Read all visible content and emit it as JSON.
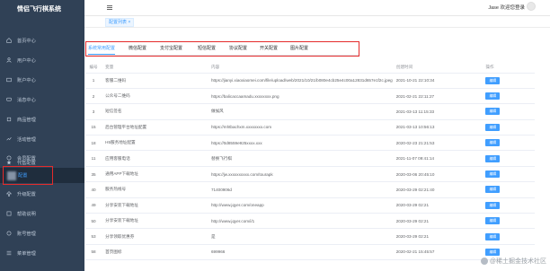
{
  "app": {
    "title": "情侣飞行棋系统"
  },
  "sidebar": {
    "items": [
      {
        "label": "首页中心",
        "icon": "home-icon"
      },
      {
        "label": "用户中心",
        "icon": "user-icon"
      },
      {
        "label": "账户中心",
        "icon": "wallet-icon"
      },
      {
        "label": "消息中心",
        "icon": "message-icon"
      },
      {
        "label": "商品管理",
        "icon": "goods-icon"
      },
      {
        "label": "活动管理",
        "icon": "activity-icon"
      },
      {
        "label": "会员配置",
        "icon": "member-icon"
      },
      {
        "label": "代售配置",
        "icon": "star-icon"
      }
    ],
    "active_sub": {
      "label": "配置"
    },
    "items_after": [
      {
        "label": "升级配置",
        "icon": "upgrade-icon"
      },
      {
        "label": "帮助说明",
        "icon": "help-icon"
      },
      {
        "label": "账号管理",
        "icon": "account-icon"
      },
      {
        "label": "菜单管理",
        "icon": "menu-icon"
      }
    ]
  },
  "header": {
    "user": "Jase 欢迎您登录"
  },
  "tags": {
    "current": "配置列表 ×"
  },
  "tabs": [
    "系统常用配置",
    "微信配置",
    "支付宝配置",
    "短信配置",
    "协议配置",
    "开关配置",
    "图片配置"
  ],
  "table": {
    "headers": [
      "编号",
      "变量",
      "内容",
      "创建时间",
      "操作"
    ],
    "action_label": "编辑",
    "rows": [
      {
        "id": "1",
        "name": "客服二维码",
        "content": "https://jianyi.xiaoxiaomei.com/file/upload/web/2021/10/21/b080e4cb25e4c00a12831d657e1f2c.jpeg",
        "content2": "",
        "time": "2021-10-21 22:10:34"
      },
      {
        "id": "2",
        "name": "公众号二维码",
        "content": "https://balicaccaamadu.xxxxxxxx.png",
        "content2": "",
        "time": "2021-02-21 22:11:27"
      },
      {
        "id": "3",
        "name": "短信签名",
        "content": "做候风",
        "content2": "",
        "time": "2021-03-13 11:15:33"
      },
      {
        "id": "15",
        "name": "后台管理平台地址配置",
        "content": "https://mhtbachxm.xxxxxxxx.com",
        "content2": "",
        "time": "2021-03-13 10:56:13"
      },
      {
        "id": "18",
        "name": "H5服务地址配置",
        "content": "https://0d8559e925xxxx.xxx",
        "content2": "",
        "time": "2020-02-23 21:21:53"
      },
      {
        "id": "11",
        "name": "应用客服电话",
        "content": "替换飞行棋",
        "content2": "",
        "time": "2021-11-07 09:41:14"
      },
      {
        "id": "35",
        "name": "通用APP下载地址",
        "content": "https://jw.xxxxxxxxxx.com/tourapk",
        "content2": "",
        "time": "2020-03-06 20:45:10"
      },
      {
        "id": "40",
        "name": "服务热线号",
        "content": "71400906d",
        "content2": "",
        "time": "2020-03-29 02:21:40"
      },
      {
        "id": "49",
        "name": "分享安装下载地址",
        "content": "http://www.jqyer.com/oneapp",
        "content2": "",
        "time": "2020-03-29 02:21"
      },
      {
        "id": "50",
        "name": "分享安装下载地址",
        "content": "http://www.jqyer.com/i/1",
        "content2": "",
        "time": "2020-03-29 02:21"
      },
      {
        "id": "53",
        "name": "分享领取优惠券",
        "content": "是",
        "content2": "",
        "time": "2020-03-29 02:21"
      },
      {
        "id": "58",
        "name": "首页图标",
        "content": "699966",
        "content2": "",
        "time": "2020-02-21 15:45:57"
      }
    ]
  },
  "watermark": {
    "text": "@稀土掘金技术社区"
  },
  "colors": {
    "sidebar": "#304156",
    "accent": "#409eff",
    "highlight": "#e52b2b"
  }
}
